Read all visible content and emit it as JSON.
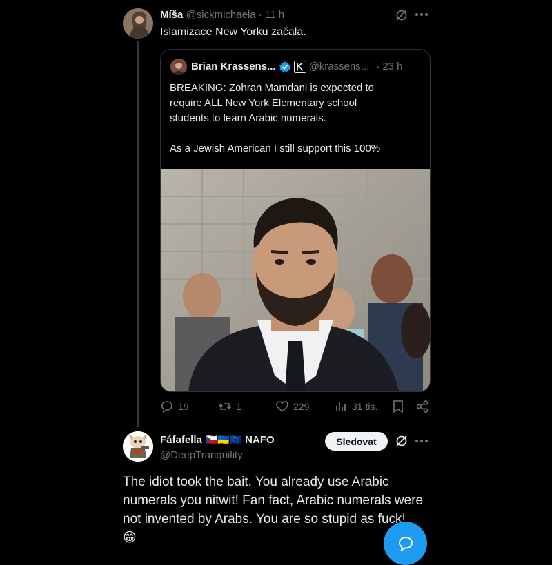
{
  "post": {
    "author_name": "Míša",
    "author_handle": "@sickmichaela",
    "separator": "·",
    "time": "11 h",
    "text": "Islamizace New Yorku začala."
  },
  "quote": {
    "author_name": "Brian Krassens...",
    "handle": "@krassens...",
    "separator": "·",
    "time": "23 h",
    "line1": "BREAKING: Zohran Mamdani is expected to",
    "line2": "require ALL New York Elementary school",
    "line3": "students to learn Arabic numerals.",
    "line4": "As a Jewish American I still support this 100%"
  },
  "actions": {
    "replies": "19",
    "reposts": "1",
    "likes": "229",
    "views": "31 tis."
  },
  "reply": {
    "author_name": "Fáfafella",
    "flags": "🇨🇿🇺🇦🇪🇺",
    "tag": "NAFO",
    "handle": "@DeepTranquility",
    "follow_label": "Sledovat",
    "line1": "The idiot took the bait. You already use Arabic",
    "line2": "numerals you nitwit! Fan fact, Arabic numerals were",
    "line3": "not invented by Arabs. You are so stupid as fuck!",
    "emoji": "😁"
  },
  "colors": {
    "background": "#000000",
    "text": "#e7e9ea",
    "muted": "#71767b",
    "accent": "#1d9bf0",
    "verified": "#1d9bf0"
  },
  "icons": [
    "grok-icon",
    "more-icon",
    "verified-badge-icon",
    "affiliate-k-icon",
    "reply-icon",
    "repost-icon",
    "like-icon",
    "views-icon",
    "bookmark-icon",
    "share-icon",
    "compose-reply-icon"
  ]
}
